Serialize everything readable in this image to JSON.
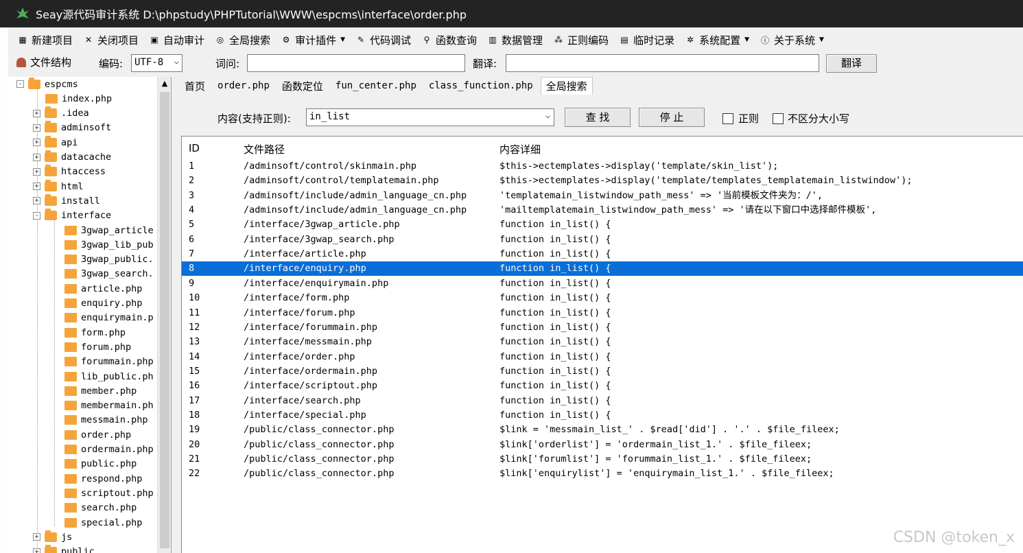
{
  "window": {
    "title": "Seay源代码审计系统  D:\\phpstudy\\PHPTutorial\\WWW\\espcms\\interface\\order.php"
  },
  "menu": [
    {
      "label": "新建项目",
      "icon": "new-project-icon"
    },
    {
      "label": "关闭项目",
      "icon": "close-project-icon"
    },
    {
      "label": "自动审计",
      "icon": "auto-audit-icon"
    },
    {
      "label": "全局搜索",
      "icon": "global-search-icon"
    },
    {
      "label": "审计插件",
      "icon": "plugin-icon",
      "dropdown": true
    },
    {
      "label": "代码调试",
      "icon": "debug-icon"
    },
    {
      "label": "函数查询",
      "icon": "function-search-icon"
    },
    {
      "label": "数据管理",
      "icon": "data-icon"
    },
    {
      "label": "正则编码",
      "icon": "regex-icon"
    },
    {
      "label": "临时记录",
      "icon": "notes-icon"
    },
    {
      "label": "系统配置",
      "icon": "gear-icon",
      "dropdown": true
    },
    {
      "label": "关于系统",
      "icon": "about-icon",
      "dropdown": true
    }
  ],
  "toolbar": {
    "file_structure": "文件结构",
    "encoding_label": "编码:",
    "encoding_value": "UTF-8",
    "word_label": "词问:",
    "word_value": "",
    "translate_label": "翻译:",
    "translate_value": "",
    "translate_button": "翻译"
  },
  "tree": {
    "root": "espcms",
    "items": [
      {
        "label": "index.php",
        "type": "file"
      },
      {
        "label": ".idea",
        "type": "folder"
      },
      {
        "label": "adminsoft",
        "type": "folder"
      },
      {
        "label": "api",
        "type": "folder"
      },
      {
        "label": "datacache",
        "type": "folder"
      },
      {
        "label": "htaccess",
        "type": "folder"
      },
      {
        "label": "html",
        "type": "folder"
      },
      {
        "label": "install",
        "type": "folder"
      },
      {
        "label": "interface",
        "type": "folder-open"
      },
      {
        "label": "3gwap_article",
        "type": "child"
      },
      {
        "label": "3gwap_lib_pub",
        "type": "child"
      },
      {
        "label": "3gwap_public.",
        "type": "child"
      },
      {
        "label": "3gwap_search.",
        "type": "child"
      },
      {
        "label": "article.php",
        "type": "child"
      },
      {
        "label": "enquiry.php",
        "type": "child"
      },
      {
        "label": "enquirymain.p",
        "type": "child"
      },
      {
        "label": "form.php",
        "type": "child"
      },
      {
        "label": "forum.php",
        "type": "child"
      },
      {
        "label": "forummain.php",
        "type": "child"
      },
      {
        "label": "lib_public.ph",
        "type": "child"
      },
      {
        "label": "member.php",
        "type": "child"
      },
      {
        "label": "membermain.ph",
        "type": "child"
      },
      {
        "label": "messmain.php",
        "type": "child"
      },
      {
        "label": "order.php",
        "type": "child"
      },
      {
        "label": "ordermain.php",
        "type": "child"
      },
      {
        "label": "public.php",
        "type": "child"
      },
      {
        "label": "respond.php",
        "type": "child"
      },
      {
        "label": "scriptout.php",
        "type": "child"
      },
      {
        "label": "search.php",
        "type": "child"
      },
      {
        "label": "special.php",
        "type": "child"
      },
      {
        "label": "js",
        "type": "folder"
      },
      {
        "label": "public",
        "type": "folder"
      }
    ]
  },
  "tabs": [
    {
      "label": "首页",
      "mono": false
    },
    {
      "label": "order.php",
      "mono": true
    },
    {
      "label": "函数定位",
      "mono": false
    },
    {
      "label": "fun_center.php",
      "mono": true
    },
    {
      "label": "class_function.php",
      "mono": true
    },
    {
      "label": "全局搜索",
      "mono": false,
      "active": true
    }
  ],
  "search": {
    "content_label": "内容(支持正则):",
    "query": "in_list",
    "find_button": "查 找",
    "stop_button": "停 止",
    "regex_label": "正则",
    "case_label": "不区分大小写"
  },
  "results": {
    "headers": [
      "ID",
      "文件路径",
      "内容详细"
    ],
    "selected_index": 7,
    "rows": [
      [
        "1",
        "/adminsoft/control/skinmain.php",
        "$this->ectemplates->display('template/skin_list');"
      ],
      [
        "2",
        "/adminsoft/control/templatemain.php",
        "$this->ectemplates->display('template/templates_templatemain_listwindow');"
      ],
      [
        "3",
        "/adminsoft/include/admin_language_cn.php",
        "'templatemain_listwindow_path_mess' => '当前模板文件夹为：/',"
      ],
      [
        "4",
        "/adminsoft/include/admin_language_cn.php",
        "'mailtemplatemain_listwindow_path_mess' => '请在以下窗口中选择邮件模板',"
      ],
      [
        "5",
        "/interface/3gwap_article.php",
        "function in_list() {"
      ],
      [
        "6",
        "/interface/3gwap_search.php",
        "function in_list() {"
      ],
      [
        "7",
        "/interface/article.php",
        "function in_list() {"
      ],
      [
        "8",
        "/interface/enquiry.php",
        "function in_list() {"
      ],
      [
        "9",
        "/interface/enquirymain.php",
        "function in_list() {"
      ],
      [
        "10",
        "/interface/form.php",
        "function in_list() {"
      ],
      [
        "11",
        "/interface/forum.php",
        "function in_list() {"
      ],
      [
        "12",
        "/interface/forummain.php",
        "function in_list() {"
      ],
      [
        "13",
        "/interface/messmain.php",
        "function in_list() {"
      ],
      [
        "14",
        "/interface/order.php",
        "function in_list() {"
      ],
      [
        "15",
        "/interface/ordermain.php",
        "function in_list() {"
      ],
      [
        "16",
        "/interface/scriptout.php",
        "function in_list() {"
      ],
      [
        "17",
        "/interface/search.php",
        "function in_list() {"
      ],
      [
        "18",
        "/interface/special.php",
        "function in_list() {"
      ],
      [
        "19",
        "/public/class_connector.php",
        "$link = 'messmain_list_' . $read['did'] . '.' . $file_fileex;"
      ],
      [
        "20",
        "/public/class_connector.php",
        "$link['orderlist'] = 'ordermain_list_1.' . $file_fileex;"
      ],
      [
        "21",
        "/public/class_connector.php",
        "$link['forumlist'] = 'forummain_list_1.' . $file_fileex;"
      ],
      [
        "22",
        "/public/class_connector.php",
        "$link['enquirylist'] = 'enquirymain_list_1.' . $file_fileex;"
      ]
    ]
  },
  "watermark": "CSDN @token_x",
  "colors": {
    "selection": "#0a6ed8",
    "folder": "#f6a43a",
    "titlebar": "#232323"
  }
}
